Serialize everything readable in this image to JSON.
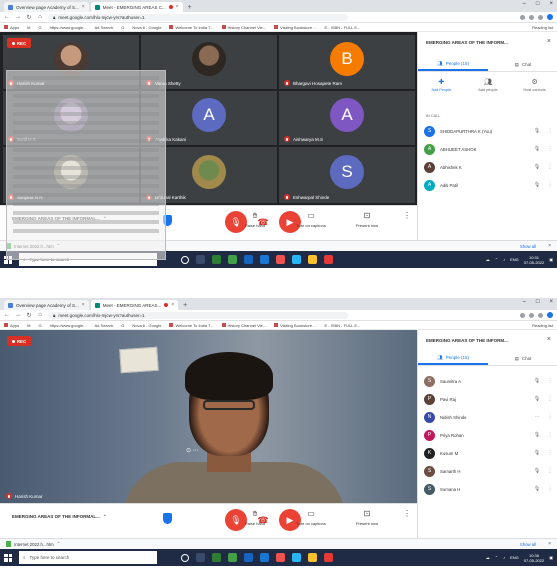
{
  "colors": {
    "meet_bg": "#202124",
    "tile_bg": "#3c4043",
    "danger": "#ea4335",
    "accent": "#1a73e8",
    "taskbar": "#1f2a44"
  },
  "shot1": {
    "tabs": [
      {
        "label": "Overview page Academy of S...",
        "icon": "doc-icon"
      },
      {
        "label": "Meet - EMERGING AREAS C...",
        "icon": "meet-icon",
        "recording": true
      }
    ],
    "url": "meet.google.com/hlo-mjcw-yrs?authuser=1",
    "bookmarks": [
      "Apps",
      "M",
      "G",
      "https://www.google...",
      "Ad Search",
      "G",
      "Nova 6 - Google",
      "Welcome To India T...",
      "History Channel Vie...",
      "Visiting Bookstore ...",
      "E - ISBN - FULL E..."
    ],
    "bookmarks_right": "Reading list",
    "rec_label": "REC",
    "tiles": [
      {
        "name": "Harish Kumar",
        "kind": "photo"
      },
      {
        "name": "Varun Shetty",
        "kind": "photo"
      },
      {
        "name": "Bhargavi Hosapete Ram",
        "kind": "letter",
        "letter": "B",
        "color": "#f57c00"
      },
      {
        "name": "Sunil H S",
        "kind": "photo"
      },
      {
        "name": "Anshika Kakani",
        "kind": "letter",
        "letter": "A",
        "color": "#5c6bc0"
      },
      {
        "name": "Aishwarya M.S",
        "kind": "letter",
        "letter": "A",
        "color": "#7e57c2"
      },
      {
        "name": "Sanjana N N",
        "kind": "photo"
      },
      {
        "name": "Dhruval Karthik",
        "kind": "photo"
      },
      {
        "name": "Eshwarpal Shinde",
        "kind": "letter",
        "letter": "S",
        "color": "#5c6bc0"
      }
    ],
    "meeting_title": "EMERGING AREAS OF THE INFORMAL...",
    "controls_right": [
      {
        "label": "Raise hand",
        "icon": "hand-icon"
      },
      {
        "label": "Turn on captions",
        "icon": "captions-icon"
      },
      {
        "label": "Present now",
        "icon": "present-icon"
      }
    ],
    "panel": {
      "title": "EMERGING AREAS OF THE INFORM...",
      "tabs": [
        {
          "label": "People (15)",
          "icon": "people-icon",
          "active": true
        },
        {
          "label": "Chat",
          "icon": "chat-icon",
          "active": false
        }
      ],
      "actions": [
        {
          "label": "Add People",
          "icon": "add-person-icon"
        },
        {
          "label": "Add people",
          "icon": "group-icon"
        },
        {
          "label": "Host controls",
          "icon": "lock-icon"
        }
      ],
      "in_call": "IN CALL",
      "participants": [
        {
          "name": "SHIDDAPURTHRA K (You)",
          "color": "#1a73e8",
          "initial": "S"
        },
        {
          "name": "ABHIJEET ASHOK",
          "color": "#43a047",
          "initial": "A"
        },
        {
          "name": "Abhishek K",
          "color": "#5d4037",
          "initial": "A"
        },
        {
          "name": "Aditi Patil",
          "color": "#00acc1",
          "initial": "A"
        }
      ]
    },
    "download_file": "Internet 2022.h...htm",
    "show_all": "Show all",
    "search_placeholder": "Type here to search",
    "tray_time": "10:31",
    "tray_date": "07-05-2022"
  },
  "shot2": {
    "tabs": [
      {
        "label": "Overview page Academy of S...",
        "icon": "doc-icon"
      },
      {
        "label": "Meet - EMERGING AREAS...",
        "icon": "meet-icon",
        "recording": true
      }
    ],
    "url": "meet.google.com/hlo-mjcw-yrs?authuser=1",
    "bookmarks": [
      "Apps",
      "M",
      "G",
      "https://www.google...",
      "Ad Search",
      "G",
      "Nova 6 - Google",
      "Welcome To India T...",
      "History Channel Vie...",
      "Visiting Bookstore ...",
      "E - ISBN - FULL E..."
    ],
    "bookmarks_right": "Reading list",
    "rec_label": "REC",
    "speaker_name": "Harish Kumar",
    "meeting_title": "EMERGING AREAS OF THE INFORMAL...",
    "controls_right": [
      {
        "label": "Raise hand",
        "icon": "hand-icon"
      },
      {
        "label": "Turn on captions",
        "icon": "captions-icon"
      },
      {
        "label": "Present now",
        "icon": "present-icon"
      }
    ],
    "panel": {
      "title": "EMERGING AREAS OF THE INFORM...",
      "tabs": [
        {
          "label": "People (15)",
          "icon": "people-icon",
          "active": true
        },
        {
          "label": "Chat",
          "icon": "chat-icon",
          "active": false
        }
      ],
      "participants": [
        {
          "name": "Saumitra A",
          "color": "#8d6e63",
          "initial": "S"
        },
        {
          "name": "Pavi Raj",
          "color": "#5d4037",
          "initial": "P"
        },
        {
          "name": "Nidish Shinde",
          "color": "#3949ab",
          "initial": "N"
        },
        {
          "name": "Priya Rohan",
          "color": "#c2185b",
          "initial": "P"
        },
        {
          "name": "Kusum M",
          "color": "#212121",
          "initial": "K"
        },
        {
          "name": "Samarth H",
          "color": "#6d4c41",
          "initial": "S"
        },
        {
          "name": "Sumana H",
          "color": "#455a64",
          "initial": "S"
        }
      ]
    },
    "download_file": "Internet 2022.h...htm",
    "show_all": "Show all",
    "search_placeholder": "Type here to search",
    "tray_time": "10:36",
    "tray_date": "07-05-2022"
  }
}
